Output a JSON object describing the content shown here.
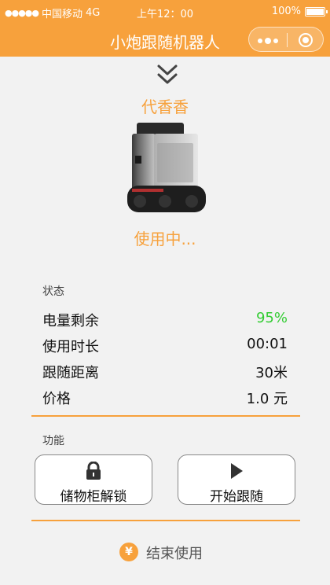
{
  "status_bar": {
    "signal_dots": "●●●●●",
    "carrier": "中国移动",
    "network": "4G",
    "time": "上午12：00",
    "battery": "100%"
  },
  "header": {
    "title": "小炮跟随机器人"
  },
  "user_name": "代香香",
  "robot_state": "使用中...",
  "status": {
    "label": "状态",
    "items": [
      {
        "key": "电量剩余",
        "value": "95%",
        "color": "#33cc33"
      },
      {
        "key": "使用时长",
        "value": "00:01",
        "color": "#111111"
      },
      {
        "key": "跟随距离",
        "value": "30米",
        "color": "#111111"
      },
      {
        "key": "价格",
        "value": "1.0 元",
        "color": "#111111"
      }
    ]
  },
  "functions": {
    "label": "功能",
    "unlock_button": "储物柜解锁",
    "follow_button": "开始跟随"
  },
  "end_use": {
    "icon_glyph": "¥",
    "label": "结束使用"
  },
  "colors": {
    "accent": "#f7a13c",
    "battery_ok": "#33cc33"
  }
}
